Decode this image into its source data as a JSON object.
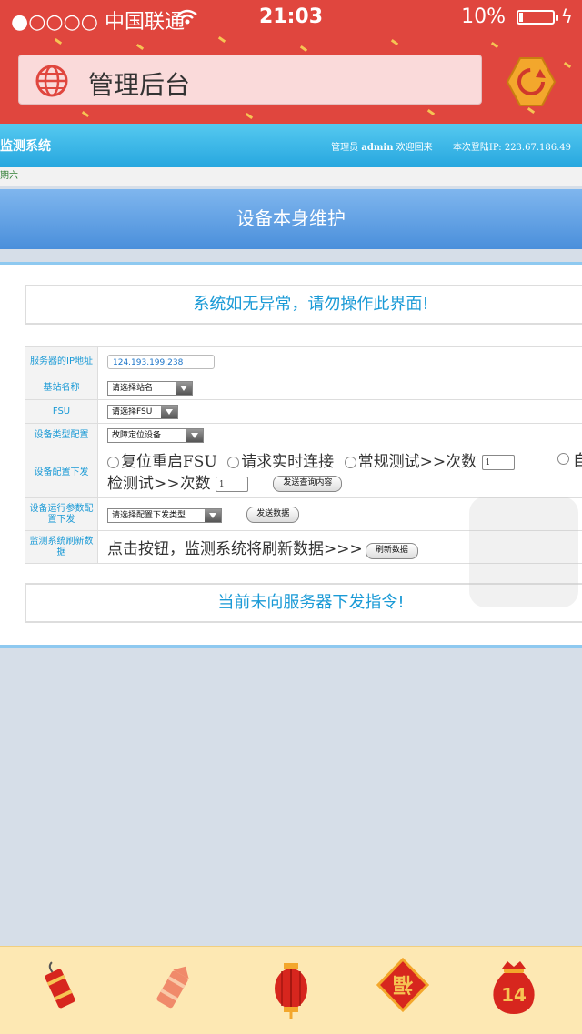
{
  "status": {
    "carrier": "●○○○○ 中国联通",
    "time": "21:03",
    "battery_text": "10%",
    "battery_level": 0.1
  },
  "app": {
    "title": "管理后台"
  },
  "banner": {
    "system": "监测系统",
    "admin_label": "管理员",
    "admin_name": "admin",
    "welcome": "欢迎回来",
    "login_ip_label": "本次登陆IP:",
    "login_ip": "223.67.186.49"
  },
  "date_text": "期六",
  "page_title": "设备本身维护",
  "notice_top": "系统如无异常，请勿操作此界面!",
  "notice_bottom": "当前未向服务器下发指令!",
  "form": {
    "ip_label": "服务器的IP地址",
    "ip_value": "124.193.199.238",
    "station_label": "基站名称",
    "station_select": "请选择站名",
    "fsu_label": "FSU",
    "fsu_select": "请选择FSU",
    "devtype_label": "设备类型配置",
    "devtype_select": "故障定位设备",
    "devconfig_label": "设备配置下发",
    "options": [
      "复位重启FSU",
      "请求实时连接",
      "常规测试>>次数",
      "自检测试>>次数"
    ],
    "count1": "1",
    "count2": "1",
    "send_query_btn": "发送查询内容",
    "runparam_label": "设备运行参数配置下发",
    "runparam_select": "请选择配置下发类型",
    "send_data_btn": "发送数据",
    "refresh_label": "监测系统刷新数据",
    "refresh_tip": "点击按钮，监测系统将刷新数据>>>",
    "refresh_btn": "刷新数据"
  },
  "tabbar": {
    "icons": [
      "firecracker-icon",
      "firecracker-icon",
      "lantern-icon",
      "fu-icon",
      "lucky-bag-icon"
    ],
    "badge": "14"
  }
}
